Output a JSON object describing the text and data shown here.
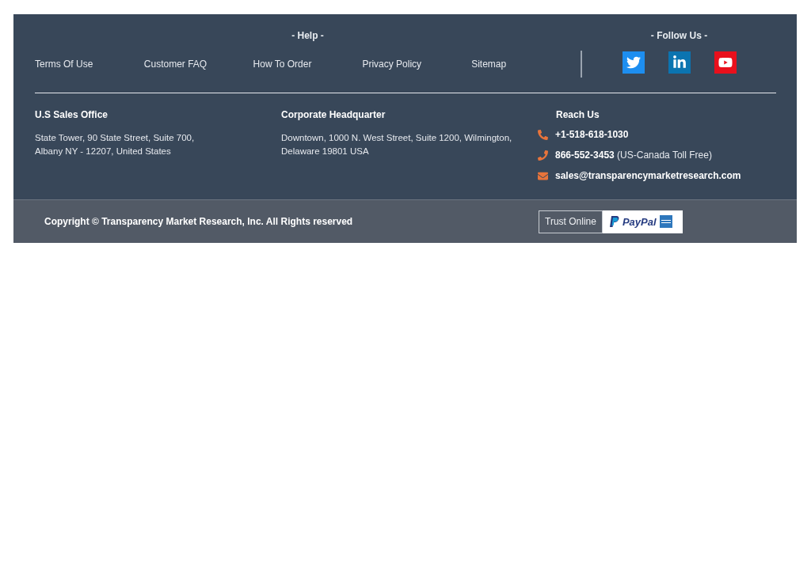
{
  "help": {
    "title": "- Help -",
    "links": [
      "Terms Of Use",
      "Customer FAQ",
      "How To Order",
      "Privacy Policy",
      "Sitemap"
    ]
  },
  "follow": {
    "title": "- Follow Us -"
  },
  "offices": [
    {
      "title": "U.S Sales Office",
      "lines": [
        "State Tower, 90 State Street, Suite 700,",
        "Albany NY - 12207, United States"
      ]
    },
    {
      "title": "Corporate Headquarter",
      "lines": [
        "Downtown, 1000 N. West Street, Suite 1200, Wilmington,",
        "Delaware 19801 USA"
      ]
    }
  ],
  "reach": {
    "title": "Reach Us",
    "contacts": [
      {
        "kind": "mobile",
        "value": "+1-518-618-1030"
      },
      {
        "kind": "landline",
        "value": "866-552-3453",
        "note": "(US-Canada Toll Free)"
      },
      {
        "kind": "email",
        "value": "sales@transparencymarketresearch.com"
      }
    ]
  },
  "bottom": {
    "copyright": "Copyright © Transparency Market Research, Inc. All Rights reserved",
    "trust": "Trust Online",
    "paypal": "PayPal"
  }
}
